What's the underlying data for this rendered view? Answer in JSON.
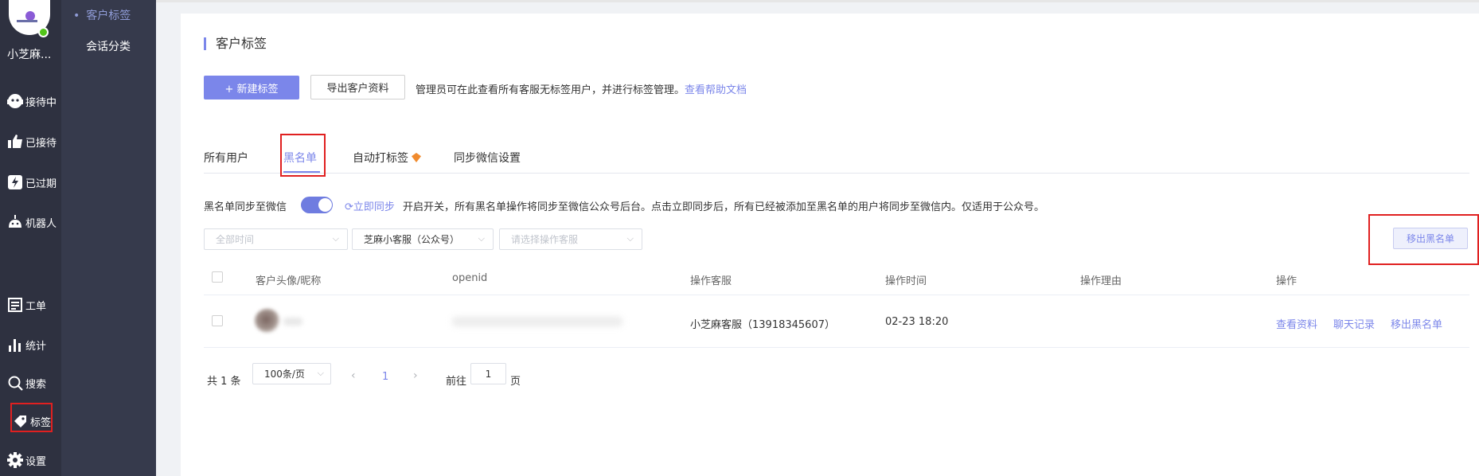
{
  "user": {
    "name": "小芝麻..."
  },
  "nav": {
    "items": [
      {
        "label": "接待中",
        "icon": "chat-face-icon"
      },
      {
        "label": "已接待",
        "icon": "thumbs-up-icon"
      },
      {
        "label": "已过期",
        "icon": "lightning-icon"
      },
      {
        "label": "机器人",
        "icon": "robot-icon"
      },
      {
        "label": "工单",
        "icon": "ticket-icon"
      },
      {
        "label": "统计",
        "icon": "bar-chart-icon"
      },
      {
        "label": "搜索",
        "icon": "search-icon"
      },
      {
        "label": "标签",
        "icon": "tag-icon"
      },
      {
        "label": "设置",
        "icon": "gear-icon"
      }
    ]
  },
  "subnav": {
    "active": "客户标签",
    "other": "会话分类"
  },
  "page": {
    "title": "客户标签",
    "new_tag_button": "+ 新建标签",
    "export_button": "导出客户资料",
    "admin_tip": "管理员可在此查看所有客服无标签用户，并进行标签管理。",
    "help_link": "查看帮助文档"
  },
  "tabs": [
    {
      "label": "所有用户"
    },
    {
      "label": "黑名单"
    },
    {
      "label": "自动打标签"
    },
    {
      "label": "同步微信设置"
    }
  ],
  "sync": {
    "label": "黑名单同步至微信",
    "toggle_on": true,
    "sync_now": "立即同步",
    "description": "开启开关，所有黑名单操作将同步至微信公众号后台。点击立即同步后，所有已经被添加至黑名单的用户将同步至微信内。仅适用于公众号。"
  },
  "filters": {
    "time_placeholder": "全部时间",
    "channel_value": "芝麻小客服（公众号）",
    "operator_placeholder": "请选择操作客服",
    "remove_button": "移出黑名单"
  },
  "table": {
    "headers": [
      "客户头像/昵称",
      "openid",
      "操作客服",
      "操作时间",
      "操作理由",
      "操作"
    ],
    "rows": [
      {
        "agent": "小芝麻客服（13918345607）",
        "time": "02-23 18:20",
        "reason": "",
        "actions": [
          "查看资料",
          "聊天记录",
          "移出黑名单"
        ]
      }
    ]
  },
  "pagination": {
    "total": "共 1 条",
    "page_size": "100条/页",
    "current_page": "1",
    "goto_label": "前往",
    "goto_value": "1",
    "page_suffix": "页"
  },
  "colors": {
    "accent": "#7b86ea",
    "sidebar": "#2e3140",
    "highlight": "#e02020"
  }
}
